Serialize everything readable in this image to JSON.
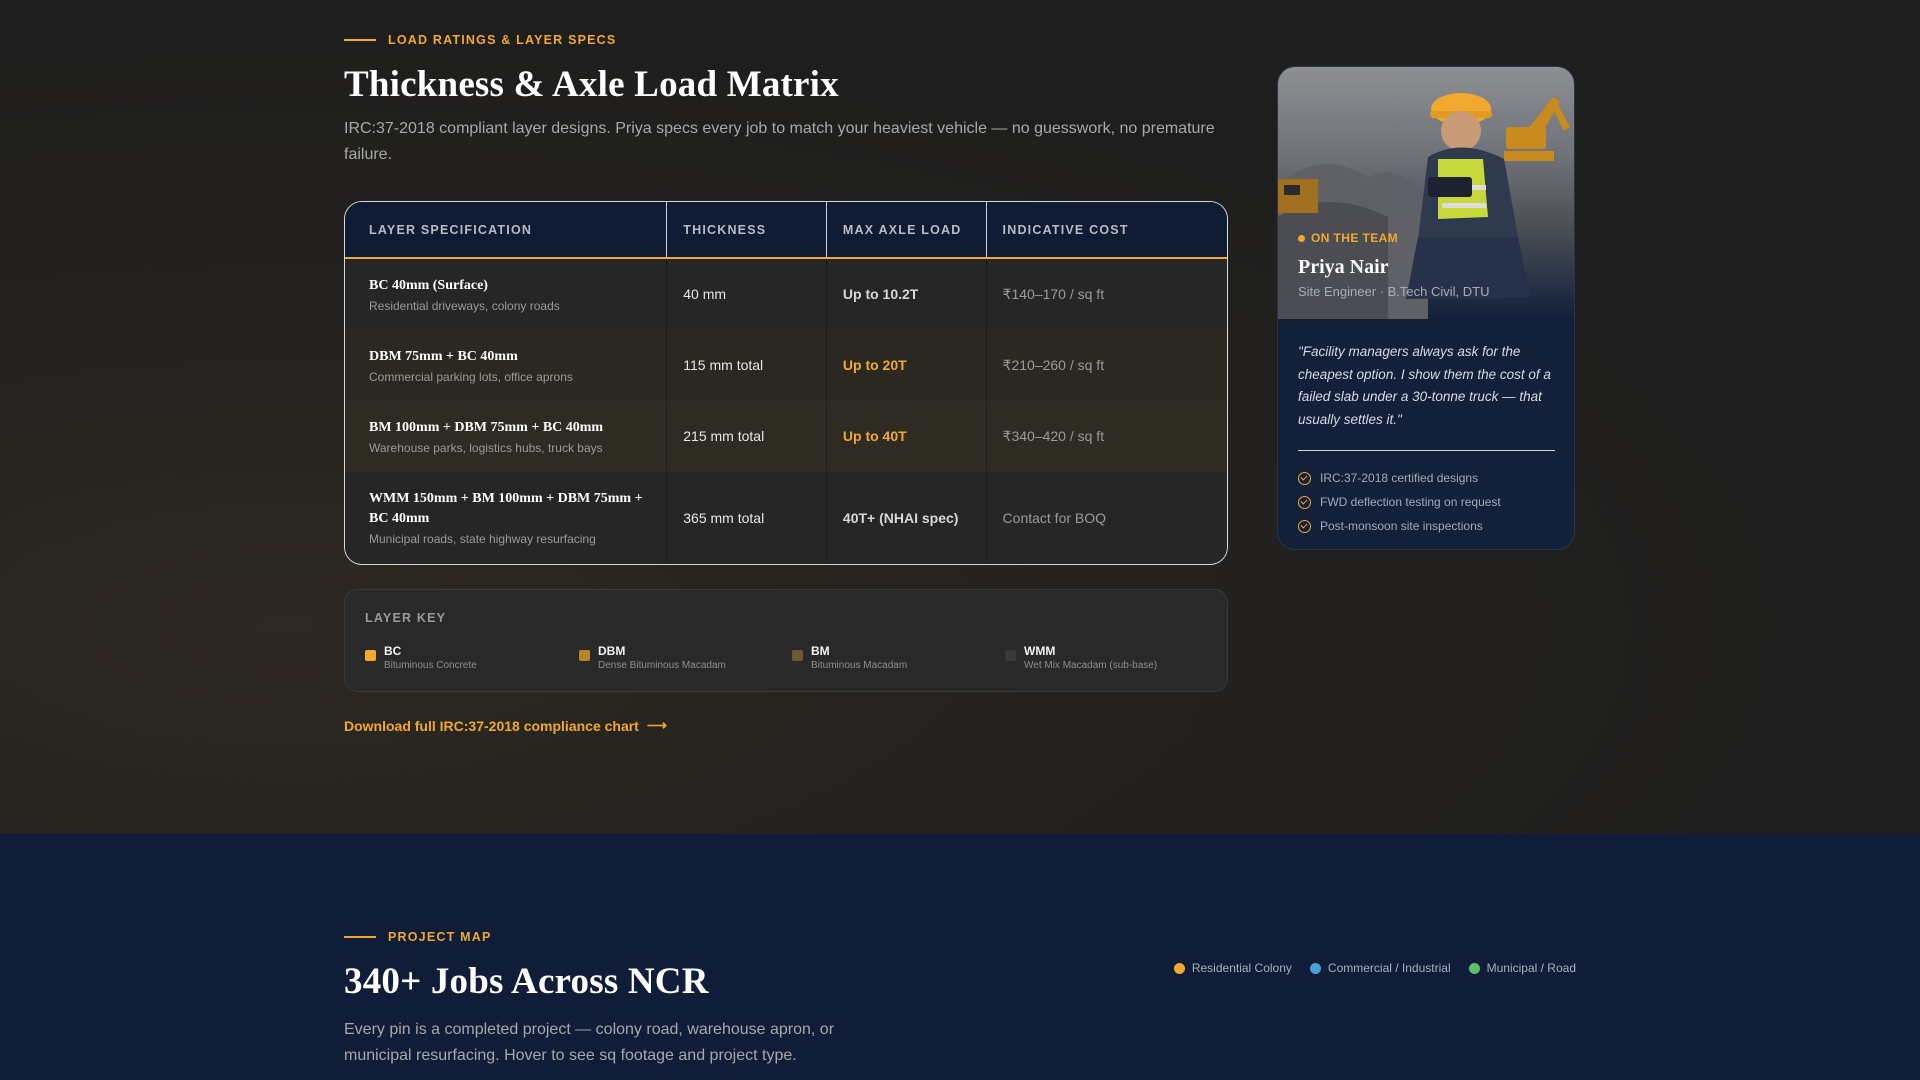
{
  "specs": {
    "eyebrow": "LOAD RATINGS & LAYER SPECS",
    "title": "Thickness & Axle Load Matrix",
    "lead": "IRC:37-2018 compliant layer designs. Priya specs every job to match your heaviest vehicle — no guesswork, no premature failure.",
    "table": {
      "headers": [
        "LAYER SPECIFICATION",
        "THICKNESS",
        "MAX AXLE LOAD",
        "INDICATIVE COST"
      ],
      "rows": [
        {
          "spec": "BC 40mm (Surface)",
          "use": "Residential driveways, colony roads",
          "thickness": "40 mm",
          "load": "Up to 10.2T",
          "cost": "₹140–170 / sq ft"
        },
        {
          "spec": "DBM 75mm + BC 40mm",
          "use": "Commercial parking lots, office aprons",
          "thickness": "115 mm total",
          "load": "Up to 20T",
          "cost": "₹210–260 / sq ft"
        },
        {
          "spec": "BM 100mm + DBM 75mm + BC 40mm",
          "use": "Warehouse parks, logistics hubs, truck bays",
          "thickness": "215 mm total",
          "load": "Up to 40T",
          "cost": "₹340–420 / sq ft"
        },
        {
          "spec": "WMM 150mm + BM 100mm + DBM 75mm + BC 40mm",
          "use": "Municipal roads, state highway resurfacing",
          "thickness": "365 mm total",
          "load": "40T+ (NHAI spec)",
          "cost": "Contact for BOQ"
        }
      ]
    },
    "layer_key": {
      "title": "LAYER KEY",
      "items": [
        {
          "name": "BC",
          "desc": "Bituminous Concrete",
          "color": "#f0a92e"
        },
        {
          "name": "DBM",
          "desc": "Dense Bituminous Macadam",
          "color": "#b9832c"
        },
        {
          "name": "BM",
          "desc": "Bituminous Macadam",
          "color": "#6e5834"
        },
        {
          "name": "WMM",
          "desc": "Wet Mix Macadam (sub-base)",
          "color": "#3a3a3a"
        }
      ]
    },
    "download": "Download full IRC:37-2018 compliance chart",
    "download_arrow": "⟶"
  },
  "team_card": {
    "badge": "ON THE TEAM",
    "name": "Priya Nair",
    "role": "Site Engineer · B.Tech Civil, DTU",
    "quote": "\"Facility managers always ask for the cheapest option. I show them the cost of a failed slab under a 30-tonne truck — that usually settles it.\"",
    "checks": [
      "IRC:37-2018 certified designs",
      "FWD deflection testing on request",
      "Post-monsoon site inspections"
    ]
  },
  "map": {
    "eyebrow": "PROJECT MAP",
    "title": "340+ Jobs Across NCR",
    "lead": "Every pin is a completed project — colony road, warehouse apron, or municipal resurfacing. Hover to see sq footage and project type.",
    "legend": [
      {
        "label": "Residential Colony",
        "color": "#f0a92e"
      },
      {
        "label": "Commercial / Industrial",
        "color": "#4a9fd8"
      },
      {
        "label": "Municipal / Road",
        "color": "#5cbf6a"
      }
    ]
  },
  "colors": {
    "accent": "#f0a92e",
    "navy": "#0f1d38"
  }
}
